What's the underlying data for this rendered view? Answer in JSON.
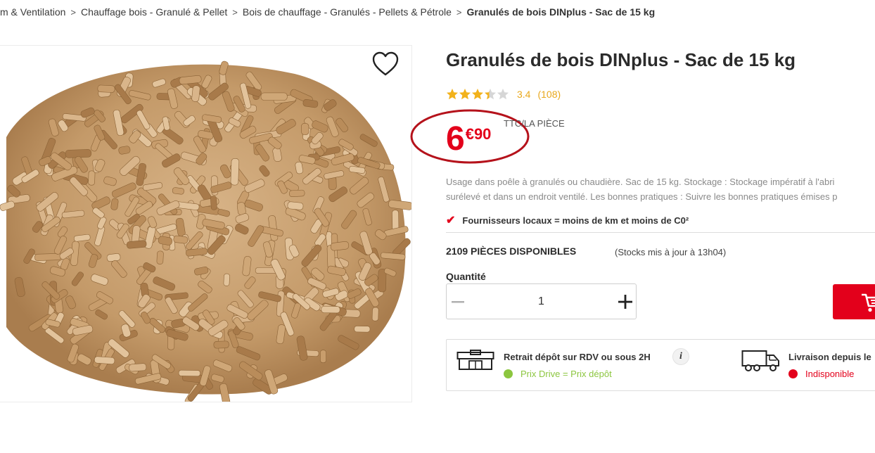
{
  "breadcrumb": {
    "items": [
      "m & Ventilation",
      "Chauffage bois - Granulé & Pellet",
      "Bois de chauffage - Granulés - Pellets & Pétrole"
    ],
    "current": "Granulés de bois DINplus - Sac de 15 kg",
    "separator": ">"
  },
  "product": {
    "title": "Granulés de bois DINplus - Sac de 15 kg",
    "rating": {
      "value": "3.4",
      "count": "(108)",
      "stars": 3.4,
      "max": 5
    },
    "price": {
      "integer": "6",
      "cents": "€90",
      "unit": "TTC/LA PIÈCE"
    },
    "description": [
      "Usage dans poêle à granulés ou chaudière. Sac de 15 kg. Stockage : Stockage impératif à l'abri",
      "surélevé et dans un endroit ventilé. Les bonnes pratiques : Suivre les bonnes pratiques émises p"
    ],
    "feature": "Fournisseurs locaux = moins de km et moins de C0²",
    "stock": {
      "available": "2109 PIÈCES DISPONIBLES",
      "note": "(Stocks mis à jour à 13h04)"
    },
    "quantity": {
      "label": "Quantité",
      "value": "1"
    }
  },
  "delivery": {
    "pickup": {
      "title": "Retrait dépôt sur RDV ou sous 2H",
      "status": "Prix Drive = Prix dépôt",
      "status_color": "#8cc63f",
      "info": "i"
    },
    "shipping": {
      "title": "Livraison depuis le",
      "status": "Indisponible",
      "status_color": "#e3001b"
    }
  },
  "colors": {
    "accent": "#e3001b",
    "star": "#f2b21b",
    "star_empty": "#d6d6d6"
  },
  "icons": [
    "heart-icon",
    "star-icon",
    "check-icon",
    "minus-icon",
    "plus-icon",
    "cart-icon",
    "store-icon",
    "truck-icon",
    "info-icon"
  ]
}
